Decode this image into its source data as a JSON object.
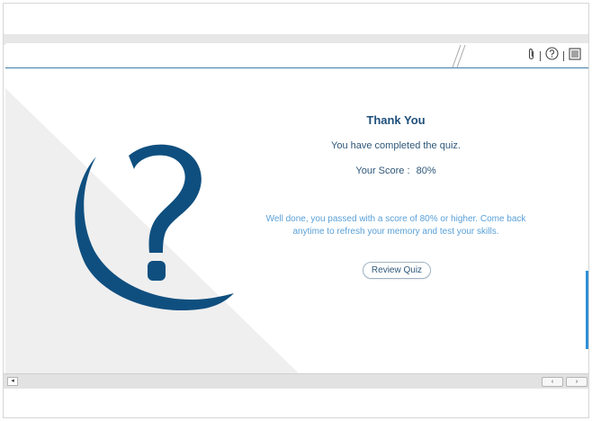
{
  "toolbar": {
    "icons": [
      "paperclip-icon",
      "help-icon",
      "menu-icon"
    ],
    "accent_line_color": "#3f7ca8"
  },
  "result": {
    "title": "Thank You",
    "completed_text": "You have completed the quiz.",
    "score_label": "Your Score :",
    "score_value": "80%",
    "message": "Well done, you passed with a score of 80% or higher. Come back anytime to refresh your memory and test your skills.",
    "review_button": "Review Quiz"
  },
  "colors": {
    "title": "#1f4f7a",
    "message": "#5aa0d8",
    "question_mark": "#0f4f7f",
    "background_shape": "#efefef"
  },
  "navigation": {
    "prev_label": "‹",
    "next_label": "›",
    "corner_label": "◂"
  }
}
